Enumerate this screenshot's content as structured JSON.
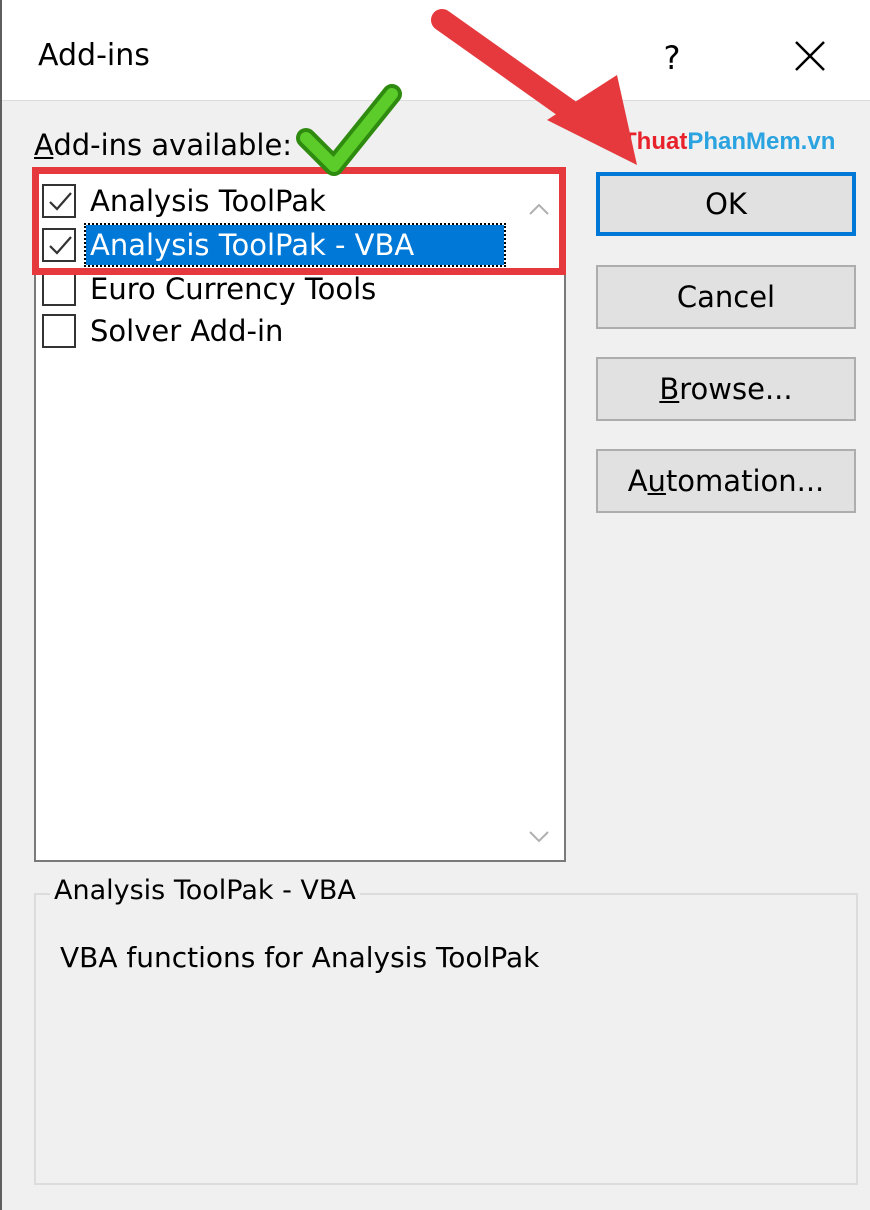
{
  "window": {
    "title": "Add-ins",
    "help_label": "?"
  },
  "list": {
    "label_prefix": "A",
    "label_rest": "dd-ins available:",
    "items": [
      {
        "label": "Analysis ToolPak",
        "checked": true,
        "selected": false
      },
      {
        "label": "Analysis ToolPak - VBA",
        "checked": true,
        "selected": true
      },
      {
        "label": "Euro Currency Tools",
        "checked": false,
        "selected": false
      },
      {
        "label": "Solver Add-in",
        "checked": false,
        "selected": false
      }
    ]
  },
  "buttons": {
    "ok": "OK",
    "cancel": "Cancel",
    "browse_key": "B",
    "browse_rest": "rowse...",
    "automation_a": "A",
    "automation_key": "u",
    "automation_rest": "tomation..."
  },
  "description": {
    "title": "Analysis ToolPak - VBA",
    "text": "VBA functions for Analysis ToolPak"
  },
  "watermark": {
    "part1": "Thuat",
    "part2": "PhanMem.vn"
  },
  "colors": {
    "accent": "#0078d7",
    "annotation_red": "#e5393d",
    "annotation_green": "#3fb618"
  }
}
